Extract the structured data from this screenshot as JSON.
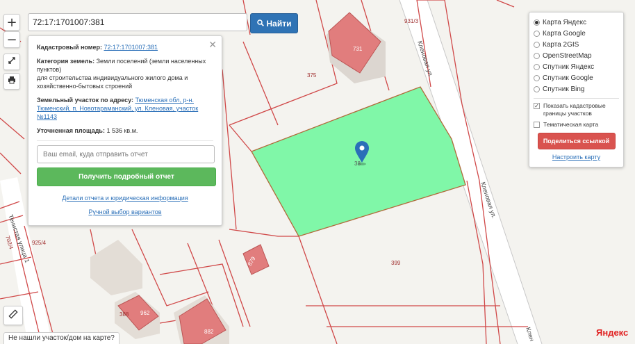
{
  "map": {
    "labels": {
      "p375": "375",
      "p731": "731",
      "p931": "931/3",
      "p38": "38",
      "p399": "399",
      "p925": "925/4",
      "p702": "702/4",
      "p879": "879",
      "p388": "388",
      "p962": "962",
      "p882": "882",
      "street_top": "Кленовая ул.",
      "street_mid": "Кленовая ул.",
      "street_bottom": "Клен",
      "street_left": "Тенистая улица 1"
    },
    "colors": {
      "parcel_selected": "#80f7a8",
      "boundary": "#d04848",
      "building": "#e17d7d",
      "road": "#ffffff"
    }
  },
  "zoom": {
    "in": "+",
    "out": "−"
  },
  "search": {
    "value": "72:17:1701007:381",
    "button_label": "Найти"
  },
  "popup": {
    "close": "✕",
    "cadastral_label": "Кадастровый номер:",
    "cadastral_value": "72:17:1701007:381",
    "category_label": "Категория земель:",
    "category_value": "Земли поселений (земли населенных пунктов)",
    "category_use": "для строительства индивидуального жилого дома и хозяйственно-бытовых строений",
    "address_label": "Земельный участок по адресу:",
    "address_value": "Тюменская обл, р-н. Тюменский, п. Новотараманский, ул. Кленовая, участок №1143",
    "area_label": "Уточненная площадь:",
    "area_value": "1 536 кв.м.",
    "email_placeholder": "Ваш email, куда отправить отчет",
    "report_button": "Получить подробный отчет",
    "details_link": "Детали отчета и юридическая информация",
    "manual_link": "Ручной выбор вариантов"
  },
  "layers": {
    "options": [
      "Карта Яндекс",
      "Карта Google",
      "Карта 2GIS",
      "OpenStreetMap",
      "Спутник Яндекс",
      "Спутник Google",
      "Спутник Bing"
    ],
    "selected": "Карта Яндекс",
    "show_boundaries": "Показать кадастровые границы участков",
    "thematic": "Тематическая карта",
    "share_button": "Поделиться ссылкой",
    "setup_link": "Настроить карту"
  },
  "bottom": {
    "not_found": "Не нашли участок/дом на карте?",
    "yandex_logo": "Яндекс"
  }
}
